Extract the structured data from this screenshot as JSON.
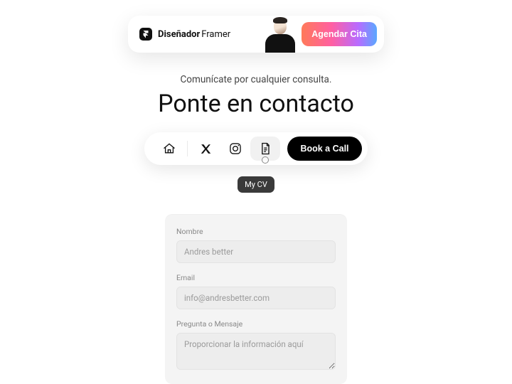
{
  "topbar": {
    "brand_bold": "Diseñador",
    "brand_light": "Framer",
    "cta_label": "Agendar Cita"
  },
  "heading": {
    "subtitle": "Comunícate por cualquier consulta.",
    "title": "Ponte en contacto"
  },
  "navbar": {
    "book_label": "Book a Call",
    "tooltip": "My CV"
  },
  "form": {
    "name_label": "Nombre",
    "name_placeholder": "Andres better",
    "email_label": "Email",
    "email_placeholder": "info@andresbetter.com",
    "message_label": "Pregunta o Mensaje",
    "message_placeholder": "Proporcionar la información aquí"
  }
}
